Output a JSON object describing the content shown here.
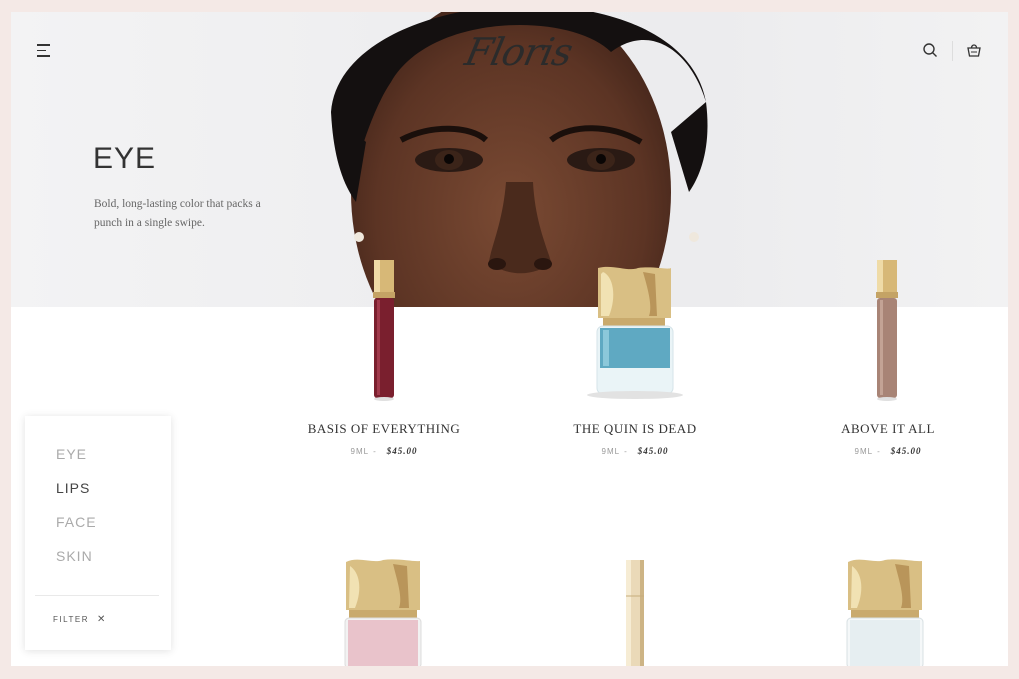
{
  "brand": {
    "logo_text": "Floris"
  },
  "header": {
    "menu_icon": "hamburger-icon",
    "search_icon": "search-icon",
    "cart_icon": "bag-icon"
  },
  "hero": {
    "title": "EYE",
    "description": "Bold, long-lasting color that packs a punch in a single swipe."
  },
  "products": [
    {
      "name": "BASIS OF EVERYTHING",
      "size": "9ML",
      "separator": "-",
      "price": "$45.00",
      "color": "#7a1f2e"
    },
    {
      "name": "THE QUIN IS DEAD",
      "size": "9ML",
      "separator": "-",
      "price": "$45.00",
      "color": "#5fa9c2"
    },
    {
      "name": "ABOVE IT ALL",
      "size": "9ML",
      "separator": "-",
      "price": "$45.00",
      "color": "#a88476"
    }
  ],
  "lower_products": [
    {
      "color": "#e9c3cb"
    },
    {
      "color": "#ead9b8"
    },
    {
      "color": "#e6eef1"
    }
  ],
  "filter_panel": {
    "categories": [
      "EYE",
      "LIPS",
      "FACE",
      "SKIN"
    ],
    "active_category": "LIPS",
    "filter_label": "FILTER",
    "close_icon": "close-icon"
  },
  "colors": {
    "page_bg": "#f4e9e6",
    "gold": "#d9bf84"
  }
}
